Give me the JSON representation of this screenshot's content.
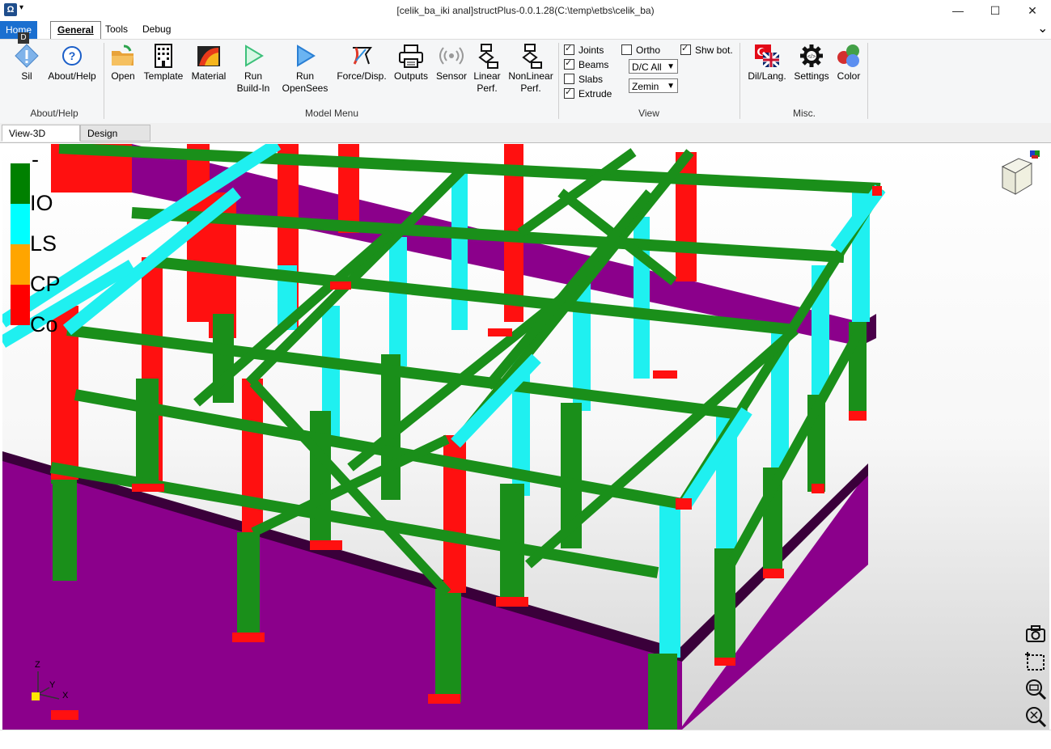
{
  "window": {
    "title": "[celik_ba_iki anal]structPlus-0.0.1.28(C:\\temp\\etbs\\celik_ba)",
    "app_icon_glyph": "Ω",
    "qa_arrow": "▾",
    "minimize": "—",
    "maximize": "☐",
    "close": "✕"
  },
  "menu": {
    "home": "Home",
    "general": "General",
    "tools": "Tools",
    "debug": "Debug",
    "badge": "D",
    "collapse": "⌄"
  },
  "ribbon": {
    "about_group": {
      "label": "About/Help",
      "sil": "Sil",
      "about": "About/Help"
    },
    "model_group": {
      "label": "Model Menu",
      "open": "Open",
      "template": "Template",
      "material": "Material",
      "run_buildin_1": "Run",
      "run_buildin_2": "Build-In",
      "run_opensees_1": "Run",
      "run_opensees_2": "OpenSees",
      "force_disp": "Force/Disp.",
      "outputs": "Outputs",
      "sensor": "Sensor",
      "linear_1": "Linear",
      "linear_2": "Perf.",
      "nonlinear_1": "NonLinear",
      "nonlinear_2": "Perf."
    },
    "view_group": {
      "label": "View",
      "joints": {
        "label": "Joints",
        "checked": true
      },
      "beams": {
        "label": "Beams",
        "checked": true
      },
      "slabs": {
        "label": "Slabs",
        "checked": false
      },
      "extrude": {
        "label": "Extrude",
        "checked": true
      },
      "ortho": {
        "label": "Ortho",
        "checked": false
      },
      "shw_bot": {
        "label": "Shw bot.",
        "checked": true
      },
      "dc_select": "D/C All",
      "floor_select": "Zemin"
    },
    "misc_group": {
      "label": "Misc.",
      "lang": "Dil/Lang.",
      "settings": "Settings",
      "color": "Color"
    }
  },
  "doc_tabs": {
    "view3d": "View-3D",
    "design": "Design"
  },
  "legend": {
    "items": [
      {
        "label": "-",
        "color": "#008000"
      },
      {
        "label": "IO",
        "color": "#00ffff"
      },
      {
        "label": "LS",
        "color": "#ffa500"
      },
      {
        "label": "CP",
        "color": "#ff0000"
      },
      {
        "label": "Co",
        "color": "#ff0000"
      }
    ]
  },
  "axes": {
    "z": "Z",
    "y": "Y",
    "x": "X"
  },
  "colors": {
    "accent": "#1a6fd0",
    "column_green": "#1a8f1a",
    "column_cyan": "#1ff0f0",
    "column_red": "#ff1010",
    "wall_purple": "#8b008b"
  },
  "view_tools": [
    "camera-icon",
    "zoom-window-icon",
    "zoom-out-icon",
    "zoom-extents-icon"
  ]
}
